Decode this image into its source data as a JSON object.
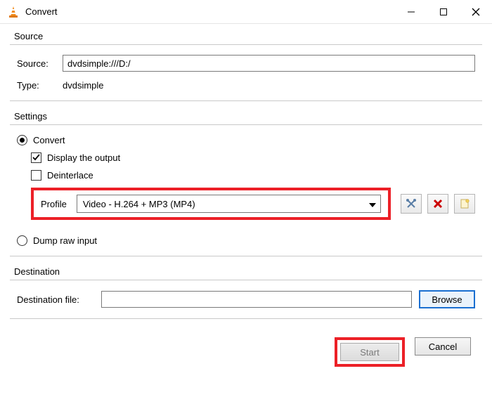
{
  "window": {
    "title": "Convert"
  },
  "source": {
    "legend": "Source",
    "source_label": "Source:",
    "source_value": "dvdsimple:///D:/",
    "type_label": "Type:",
    "type_value": "dvdsimple"
  },
  "settings": {
    "legend": "Settings",
    "convert_label": "Convert",
    "display_output_label": "Display the output",
    "deinterlace_label": "Deinterlace",
    "profile_label": "Profile",
    "profile_value": "Video - H.264 + MP3 (MP4)",
    "dump_label": "Dump raw input"
  },
  "destination": {
    "legend": "Destination",
    "file_label": "Destination file:",
    "file_value": "",
    "browse_label": "Browse"
  },
  "footer": {
    "start_label": "Start",
    "cancel_label": "Cancel"
  }
}
